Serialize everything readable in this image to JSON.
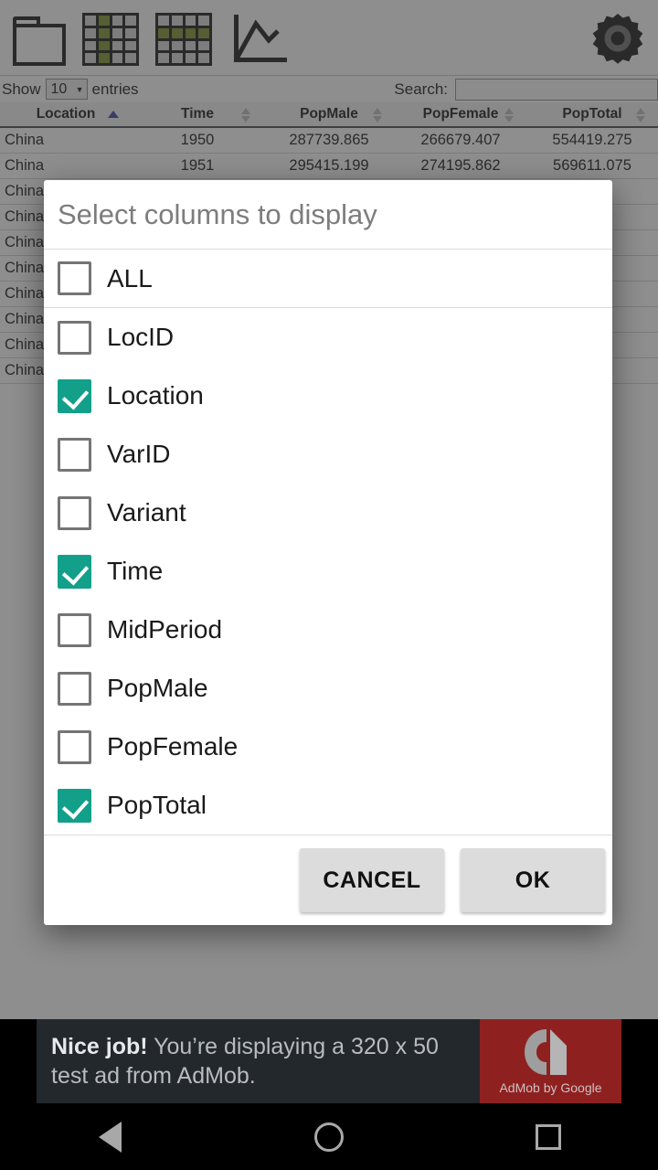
{
  "toolbar": {
    "icons": [
      {
        "name": "folder-icon",
        "label": "Open file"
      },
      {
        "name": "table-column-icon",
        "label": "Column view"
      },
      {
        "name": "table-row-icon",
        "label": "Row view"
      },
      {
        "name": "line-chart-icon",
        "label": "Chart view"
      },
      {
        "name": "gear-icon",
        "label": "Settings"
      }
    ]
  },
  "controls": {
    "show_prefix": "Show",
    "entries_value": "10",
    "entries_suffix": "entries",
    "caret": "▼",
    "search_label": "Search:",
    "search_value": "",
    "search_placeholder": ""
  },
  "table": {
    "columns": [
      {
        "label": "Location",
        "sort": "asc"
      },
      {
        "label": "Time",
        "sort": "none"
      },
      {
        "label": "PopMale",
        "sort": "none"
      },
      {
        "label": "PopFemale",
        "sort": "none"
      },
      {
        "label": "PopTotal",
        "sort": "none"
      }
    ],
    "rows": [
      [
        "China",
        "1950",
        "287739.865",
        "266679.407",
        "554419.275"
      ],
      [
        "China",
        "1951",
        "295415.199",
        "274195.862",
        "569611.075"
      ],
      [
        "China",
        "",
        "",
        "",
        ""
      ],
      [
        "China",
        "",
        "",
        "",
        ""
      ],
      [
        "China",
        "",
        "",
        "",
        ""
      ],
      [
        "China",
        "",
        "",
        "",
        ""
      ],
      [
        "China",
        "",
        "",
        "",
        ""
      ],
      [
        "China",
        "",
        "",
        "",
        ""
      ],
      [
        "China",
        "",
        "",
        "",
        ""
      ],
      [
        "China",
        "",
        "",
        "",
        ""
      ]
    ]
  },
  "dialog": {
    "title": "Select columns to display",
    "items": [
      {
        "label": "ALL",
        "checked": false
      },
      {
        "label": "LocID",
        "checked": false
      },
      {
        "label": "Location",
        "checked": true
      },
      {
        "label": "VarID",
        "checked": false
      },
      {
        "label": "Variant",
        "checked": false
      },
      {
        "label": "Time",
        "checked": true
      },
      {
        "label": "MidPeriod",
        "checked": false
      },
      {
        "label": "PopMale",
        "checked": false
      },
      {
        "label": "PopFemale",
        "checked": false
      },
      {
        "label": "PopTotal",
        "checked": true
      }
    ],
    "cancel_label": "CANCEL",
    "ok_label": "OK",
    "checked_color": "#12a08a"
  },
  "ad": {
    "headline": "Nice job!",
    "body": " You’re displaying a 320 x 50 test ad from AdMob.",
    "caption": "AdMob by Google",
    "brand_color": "#8e2120"
  },
  "navbar": {
    "back": "back-button",
    "home": "home-button",
    "recents": "recents-button"
  }
}
